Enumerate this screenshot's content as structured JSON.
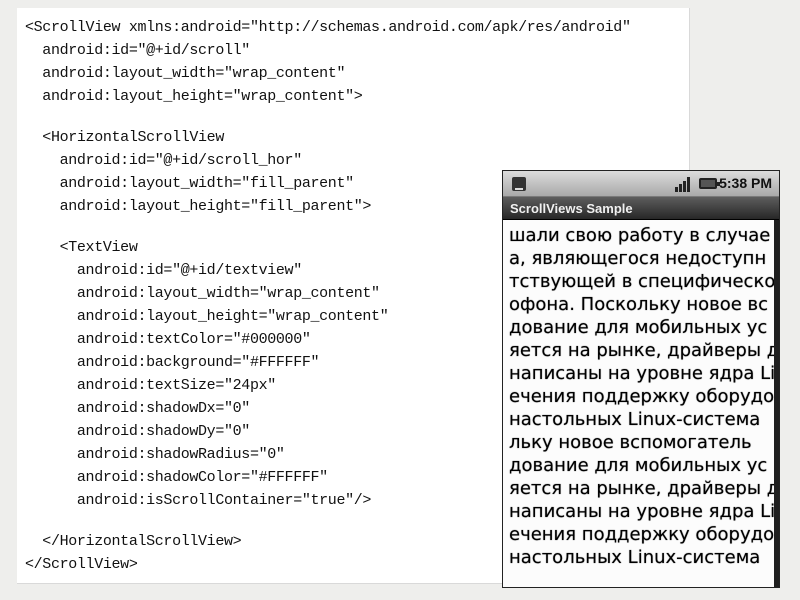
{
  "code": {
    "lines": [
      "<ScrollView xmlns:android=\"http://schemas.android.com/apk/res/android\"",
      "  android:id=\"@+id/scroll\"",
      "  android:layout_width=\"wrap_content\"",
      "  android:layout_height=\"wrap_content\">",
      "",
      "  <HorizontalScrollView",
      "    android:id=\"@+id/scroll_hor\"",
      "    android:layout_width=\"fill_parent\"",
      "    android:layout_height=\"fill_parent\">",
      "",
      "    <TextView",
      "      android:id=\"@+id/textview\"",
      "      android:layout_width=\"wrap_content\"",
      "      android:layout_height=\"wrap_content\"",
      "      android:textColor=\"#000000\"",
      "      android:background=\"#FFFFFF\"",
      "      android:textSize=\"24px\"",
      "      android:shadowDx=\"0\"",
      "      android:shadowDy=\"0\"",
      "      android:shadowRadius=\"0\"",
      "      android:shadowColor=\"#FFFFFF\"",
      "      android:isScrollContainer=\"true\"/>",
      "",
      "  </HorizontalScrollView>",
      "</ScrollView>"
    ]
  },
  "phone": {
    "status_bar": {
      "time": "5:38 PM",
      "icons": [
        "notification-icon",
        "signal-icon",
        "battery-icon"
      ]
    },
    "app_title": "ScrollViews Sample",
    "text_lines": [
      "шали свою работу в случае",
      "а, являющегося недоступн",
      "тствующей в специфическо",
      "офона. Поскольку новое вс",
      "дование для мобильных ус",
      "яется на рынке, драйверы д",
      "написаны на уровне ядра Li",
      "ечения поддержку оборудо",
      "настольных Linux-система",
      "льку новое вспомогатель",
      "дование для мобильных ус",
      "яется на рынке, драйверы д",
      "написаны на уровне ядра Li",
      "ечения поддержку оборудо",
      "настольных Linux-система"
    ]
  },
  "colors": {
    "background": "#eeeeec",
    "code_panel": "#ffffff",
    "status_bar": "#b8b8b8",
    "title_bar": "#3a3a3a",
    "text": "#000000"
  }
}
